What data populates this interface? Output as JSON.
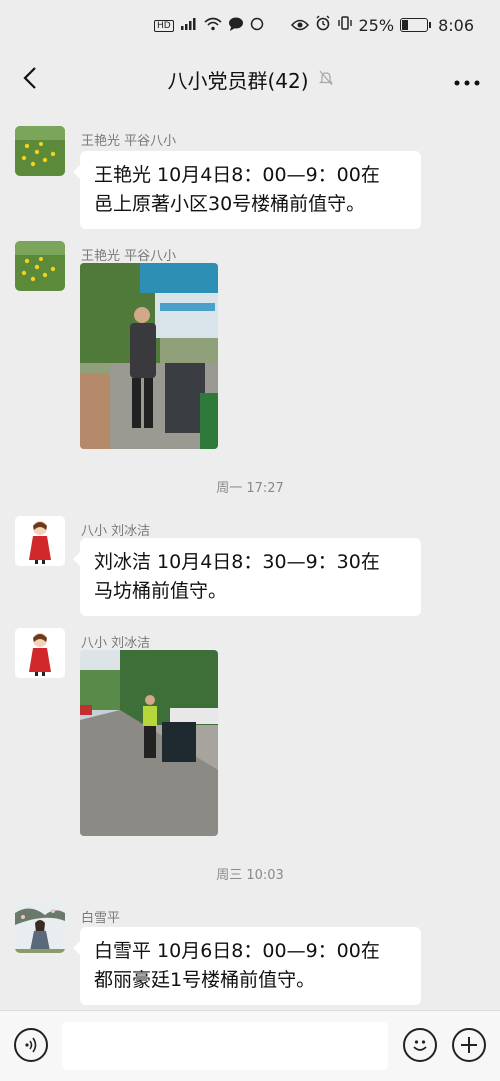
{
  "status_bar": {
    "left_icons": [
      "HD",
      "4G-signal",
      "wifi-icon",
      "chat-notification-icon",
      "circle-icon"
    ],
    "hd_label": "HD",
    "battery_percent": "25%",
    "battery_level": 0.25,
    "time": "8:06"
  },
  "header": {
    "title": "八小党员群(42)"
  },
  "messages": [
    {
      "type": "text",
      "sender": "王艳光  平谷八小",
      "text": "王艳光 10月4日8：00—9：00在\n邑上原著小区30号楼桶前值守。"
    },
    {
      "type": "image",
      "sender": "王艳光  平谷八小"
    },
    {
      "type": "time",
      "text": "周一 17:27"
    },
    {
      "type": "text",
      "sender": "八小 刘冰洁",
      "text": "刘冰洁 10月4日8：30—9：30在\n马坊桶前值守。"
    },
    {
      "type": "image",
      "sender": "八小 刘冰洁"
    },
    {
      "type": "time",
      "text": "周三 10:03"
    },
    {
      "type": "text",
      "sender": "白雪平",
      "text": "白雪平 10月6日8：00—9：00在\n都丽豪廷1号楼桶前值守。"
    }
  ],
  "colors": {
    "background": "#ededed",
    "bubble": "#ffffff",
    "meta_text": "#7a7a7a"
  }
}
